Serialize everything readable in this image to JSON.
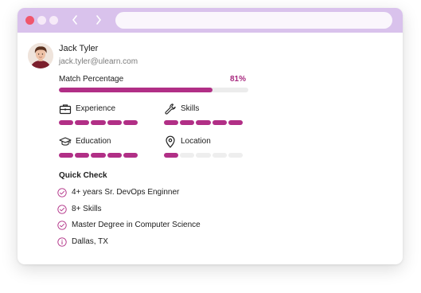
{
  "browser": {
    "url": ""
  },
  "profile": {
    "name": "Jack Tyler",
    "email": "jack.tyler@ulearn.com"
  },
  "match": {
    "label": "Match Percentage",
    "percent_text": "81%",
    "percent": 81
  },
  "categories": [
    {
      "label": "Experience",
      "icon": "briefcase-icon",
      "filled": 5,
      "total": 5
    },
    {
      "label": "Skills",
      "icon": "wrench-icon",
      "filled": 5,
      "total": 5
    },
    {
      "label": "Education",
      "icon": "graduation-cap-icon",
      "filled": 5,
      "total": 5
    },
    {
      "label": "Location",
      "icon": "map-pin-icon",
      "filled": 1,
      "total": 5
    }
  ],
  "quick_check": {
    "title": "Quick Check",
    "items": [
      {
        "text": "4+ years Sr. DevOps Enginner",
        "icon": "check-circle-icon"
      },
      {
        "text": "8+ Skills",
        "icon": "check-circle-icon"
      },
      {
        "text": "Master Degree in Computer Science",
        "icon": "check-circle-icon"
      },
      {
        "text": "Dallas, TX",
        "icon": "info-circle-icon"
      }
    ]
  },
  "colors": {
    "accent": "#b12f86",
    "accent_text": "#a8297f",
    "titlebar": "#d9c2ec",
    "track": "#eeeeee"
  }
}
